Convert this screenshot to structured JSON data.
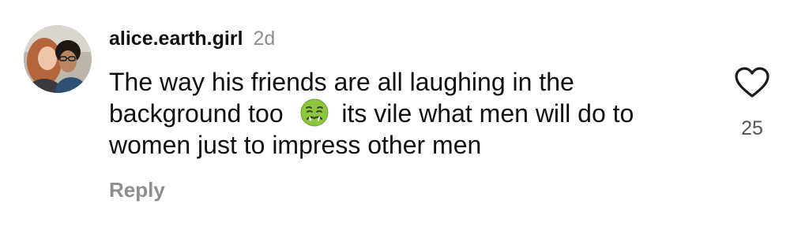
{
  "comment": {
    "username": "alice.earth.girl",
    "timestamp": "2d",
    "text_part1": "The way his friends are all laughing in the background too",
    "emoji": "nauseated-face-icon",
    "text_part2": "its vile what men will do to women just to impress other men",
    "reply_label": "Reply",
    "like_count": "25",
    "like_icon": "heart-outline-icon",
    "avatar": "avatar"
  },
  "colors": {
    "text": "#111111",
    "muted": "#8e8e8e",
    "like_count": "#555555",
    "emoji_green": "#8cc63f"
  }
}
